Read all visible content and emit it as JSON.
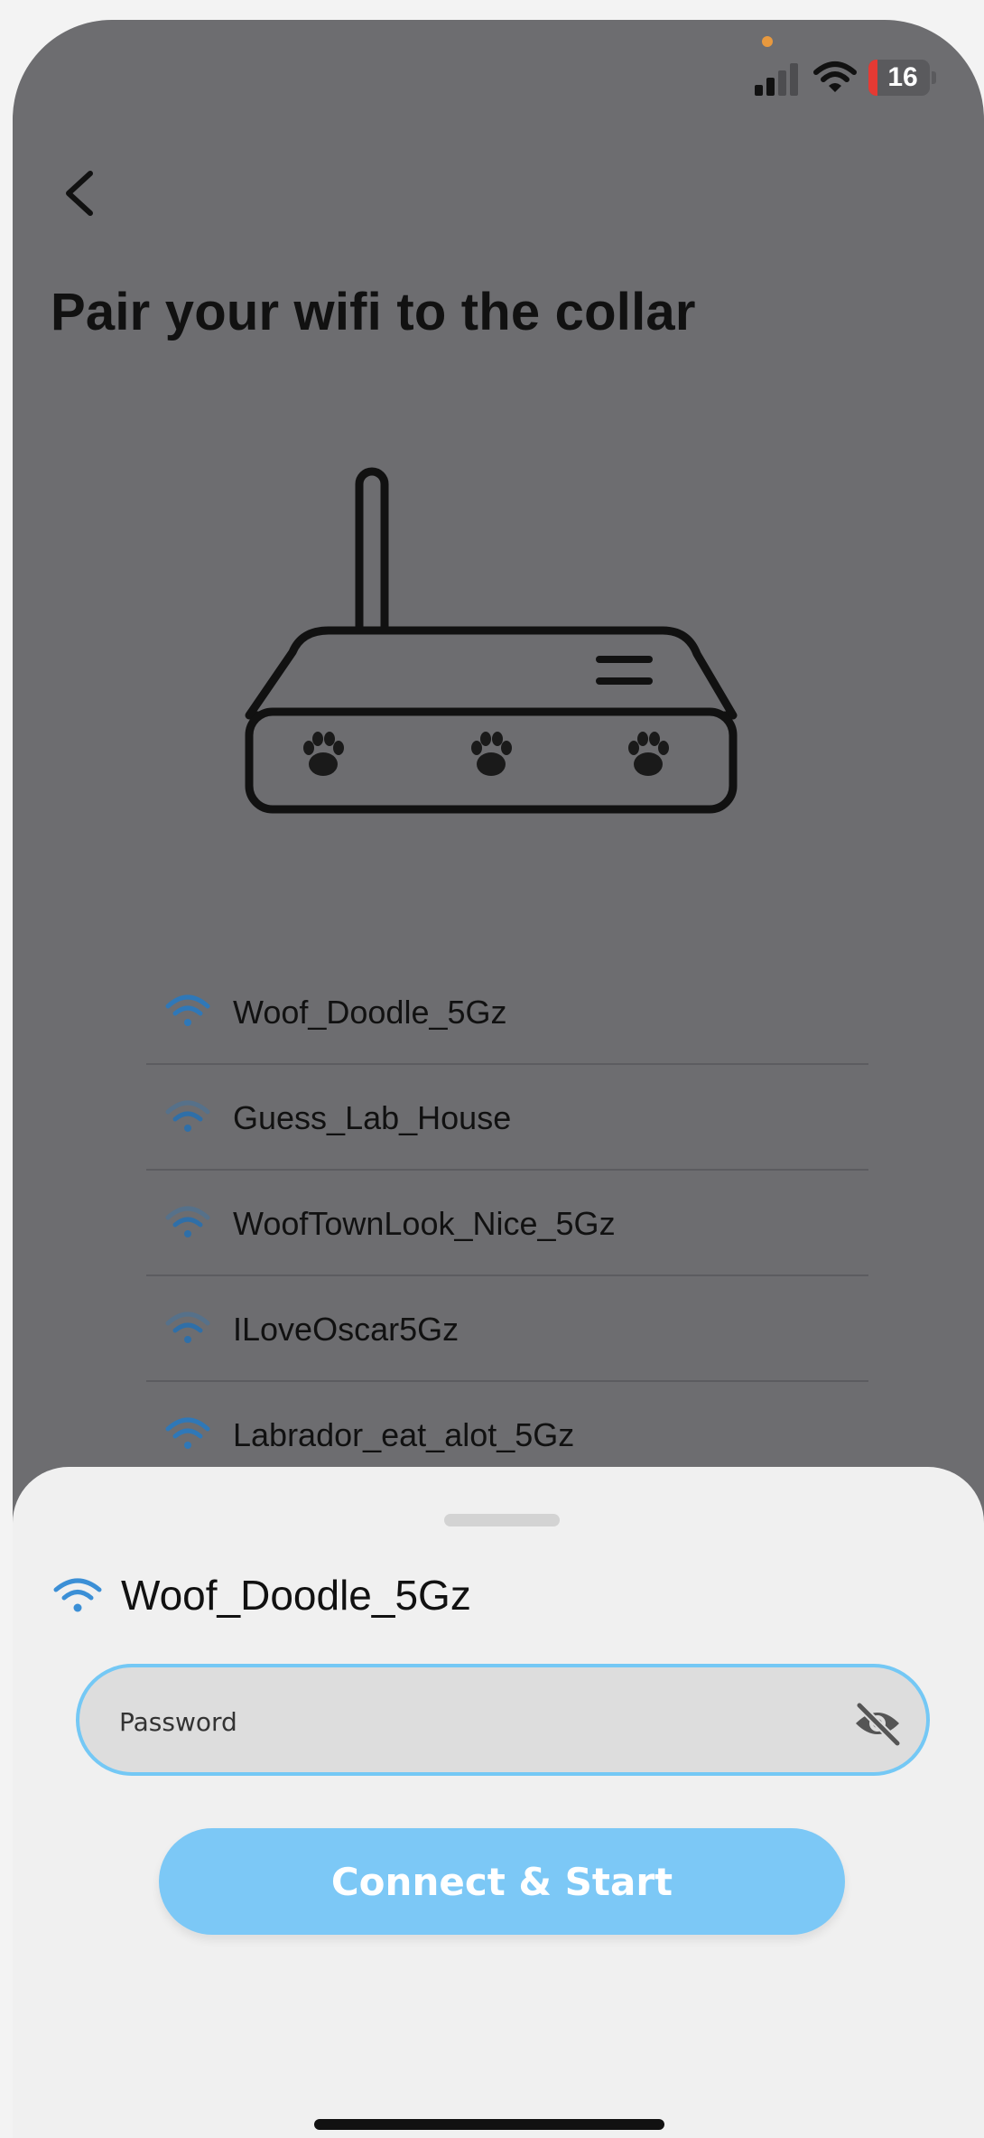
{
  "status_bar": {
    "battery": "16"
  },
  "page": {
    "title": "Pair your wifi to the collar"
  },
  "networks": [
    {
      "name": "Woof_Doodle_5Gz"
    },
    {
      "name": "Guess_Lab_House"
    },
    {
      "name": "WoofTownLook_Nice_5Gz"
    },
    {
      "name": "ILoveOscar5Gz"
    },
    {
      "name": "Labrador_eat_alot_5Gz"
    }
  ],
  "sheet": {
    "selected_network": "Woof_Doodle_5Gz",
    "password_placeholder": "Password",
    "connect_label": "Connect & Start"
  },
  "colors": {
    "accent": "#7cc8f6",
    "wifi_icon": "#3b8fd6",
    "overlay": "#6d6d70"
  }
}
